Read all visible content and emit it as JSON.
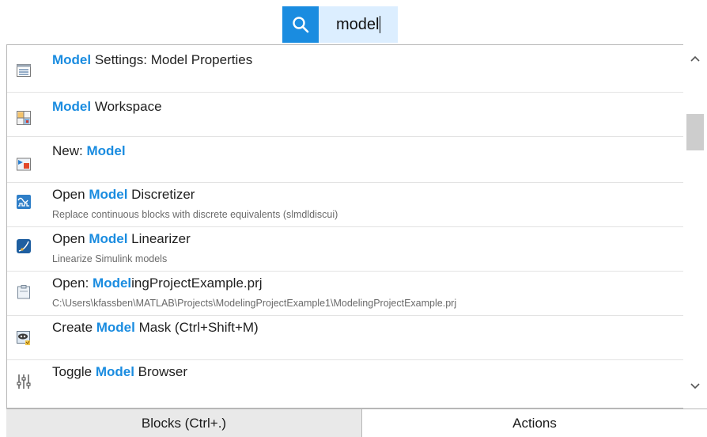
{
  "search": {
    "query": "model"
  },
  "results": [
    {
      "icon": "settings-panel-icon",
      "pre": "",
      "hl": "Model",
      "post": " Settings: Model Properties",
      "sub": ""
    },
    {
      "icon": "workspace-icon",
      "pre": "",
      "hl": "Model",
      "post": " Workspace",
      "sub": ""
    },
    {
      "icon": "new-model-icon",
      "pre": "New: ",
      "hl": "Model",
      "post": "",
      "sub": ""
    },
    {
      "icon": "discretizer-icon",
      "pre": "Open ",
      "hl": "Model",
      "post": " Discretizer",
      "sub": "Replace continuous blocks with discrete equivalents (slmdldiscui)"
    },
    {
      "icon": "linearizer-icon",
      "pre": "Open ",
      "hl": "Model",
      "post": " Linearizer",
      "sub": "Linearize Simulink models"
    },
    {
      "icon": "project-file-icon",
      "pre": "Open: ",
      "hl": "Model",
      "post": "ingProjectExample.prj",
      "sub": "C:\\Users\\kfassben\\MATLAB\\Projects\\ModelingProjectExample1\\ModelingProjectExample.prj"
    },
    {
      "icon": "mask-icon",
      "pre": "Create ",
      "hl": "Model",
      "post": " Mask (Ctrl+Shift+M)",
      "sub": ""
    },
    {
      "icon": "sliders-icon",
      "pre": "Toggle ",
      "hl": "Model",
      "post": " Browser",
      "sub": ""
    }
  ],
  "tabs": {
    "blocks": "Blocks (Ctrl+.)",
    "actions": "Actions"
  },
  "colors": {
    "accent": "#1a8ce0",
    "search_field_bg": "#dceeff"
  }
}
